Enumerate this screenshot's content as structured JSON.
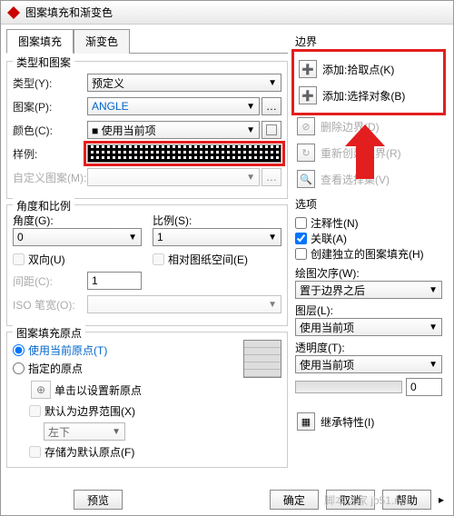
{
  "window": {
    "title": "图案填充和渐变色"
  },
  "tabs": {
    "hatch": "图案填充",
    "gradient": "渐变色"
  },
  "type_pattern": {
    "group": "类型和图案",
    "type_lbl": "类型(Y):",
    "type_val": "预定义",
    "pattern_lbl": "图案(P):",
    "pattern_val": "ANGLE",
    "color_lbl": "颜色(C):",
    "color_val": "■ 使用当前项",
    "sample_lbl": "样例:",
    "custom_lbl": "自定义图案(M):"
  },
  "angle_scale": {
    "group": "角度和比例",
    "angle_lbl": "角度(G):",
    "angle_val": "0",
    "scale_lbl": "比例(S):",
    "scale_val": "1",
    "double_lbl": "双向(U)",
    "paper_lbl": "相对图纸空间(E)",
    "spacing_lbl": "间距(C):",
    "spacing_val": "1",
    "iso_lbl": "ISO 笔宽(O):"
  },
  "origin": {
    "group": "图案填充原点",
    "use_current": "使用当前原点(T)",
    "specified": "指定的原点",
    "click_set": "单击以设置新原点",
    "default_bound": "默认为边界范围(X)",
    "pos": "左下",
    "store": "存储为默认原点(F)"
  },
  "boundary": {
    "title": "边界",
    "pick": "添加:拾取点(K)",
    "select": "添加:选择对象(B)",
    "remove": "删除边界(D)",
    "recreate": "重新创建边界(R)",
    "view": "查看选择集(V)"
  },
  "options": {
    "title": "选项",
    "annotative": "注释性(N)",
    "assoc": "关联(A)",
    "independent": "创建独立的图案填充(H)",
    "draw_order_lbl": "绘图次序(W):",
    "draw_order_val": "置于边界之后",
    "layer_lbl": "图层(L):",
    "layer_val": "使用当前项",
    "trans_lbl": "透明度(T):",
    "trans_val": "使用当前项",
    "trans_num": "0"
  },
  "inherit": "继承特性(I)",
  "footer": {
    "preview": "预览",
    "ok": "确定",
    "cancel": "取消",
    "help": "帮助"
  },
  "watermark": "脚本之家 jb51.net"
}
